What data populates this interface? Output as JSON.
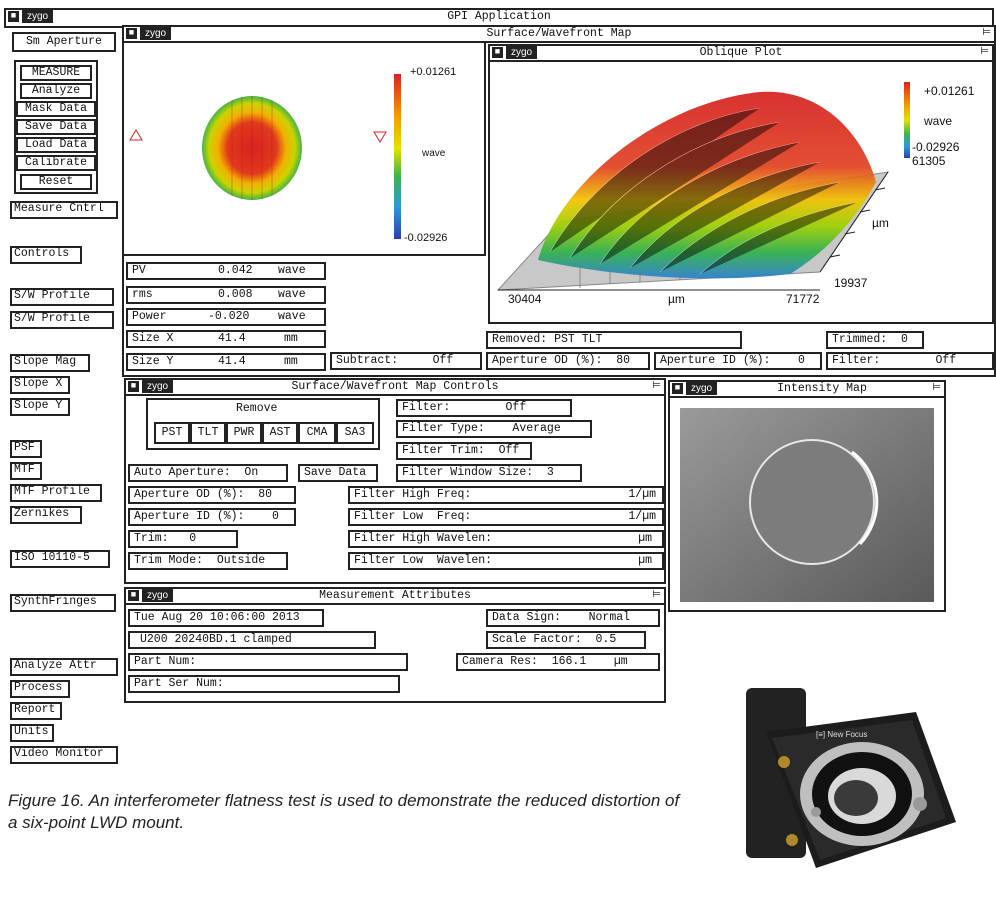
{
  "app": {
    "title": "GPI Application",
    "logo": "zygo"
  },
  "colors": {
    "frame": "#222222",
    "accent_red": "#dd2222",
    "accent_blue": "#2a3fb0"
  },
  "left_menu": {
    "sm_aperture": "Sm Aperture",
    "measure_group": [
      "MEASURE",
      "Analyze",
      "Mask Data",
      "Save Data",
      "Load Data",
      "Calibrate",
      "Reset"
    ],
    "measure_cntrl": "Measure Cntrl",
    "controls": "Controls",
    "sw_profile_1": "S/W Profile",
    "sw_profile_2": "S/W Profile",
    "slope_mag": "Slope Mag",
    "slope_x": "Slope X",
    "slope_y": "Slope Y",
    "psf": "PSF",
    "mtf": "MTF",
    "mtf_profile": "MTF Profile",
    "zernikes": "Zernikes",
    "iso": "ISO 10110-5",
    "synthfringes": "SynthFringes",
    "analyze_attr": "Analyze Attr",
    "process": "Process",
    "report": "Report",
    "units": "Units",
    "video_monitor": "Video Monitor"
  },
  "surface_map": {
    "title": "Surface/Wavefront Map",
    "colorbar_max": "+0.01261",
    "colorbar_min": "-0.02926",
    "colorbar_unit": "wave",
    "stats": [
      {
        "label": "PV",
        "value": "0.042",
        "unit": "wave"
      },
      {
        "label": "rms",
        "value": "0.008",
        "unit": "wave"
      },
      {
        "label": "Power",
        "value": "-0.020",
        "unit": "wave"
      },
      {
        "label": "Size X",
        "value": "41.4",
        "unit": "mm"
      },
      {
        "label": "Size Y",
        "value": "41.4",
        "unit": "mm"
      }
    ],
    "subtract": "Subtract:     Off",
    "removed": "Removed: PST TLT",
    "trimmed": "Trimmed:  0",
    "aperture_od": "Aperture OD (%):  80",
    "aperture_id": "Aperture ID (%):    0",
    "filter": "Filter:        Off"
  },
  "oblique_plot": {
    "title": "Oblique Plot",
    "legend_max": "+0.01261",
    "legend_unit": "wave",
    "legend_min": "-0.02926",
    "legend_min2": "61305",
    "axis_x_start": "30404",
    "axis_x_unit": "µm",
    "axis_x_end": "71772",
    "axis_y_unit": "µm",
    "axis_y_val": "19937"
  },
  "map_controls": {
    "title": "Surface/Wavefront Map Controls",
    "remove_label": "Remove",
    "remove_buttons": [
      "PST",
      "TLT",
      "PWR",
      "AST",
      "CMA",
      "SA3"
    ],
    "filter": "Filter:        Off",
    "filter_type": "Filter Type:    Average",
    "filter_trim": "Filter Trim:  Off",
    "auto_aperture": "Auto Aperture:  On",
    "save_data": "Save Data",
    "filter_window": "Filter Window Size:  3",
    "aperture_od": "Aperture OD (%):  80",
    "aperture_id": "Aperture ID (%):    0",
    "trim": "Trim:   0",
    "trim_mode": "Trim Mode:  Outside",
    "filter_rows": [
      {
        "label": "Filter High Freq:",
        "unit": "1/µm"
      },
      {
        "label": "Filter Low  Freq:",
        "unit": "1/µm"
      },
      {
        "label": "Filter High Wavelen:",
        "unit": "µm"
      },
      {
        "label": "Filter Low  Wavelen:",
        "unit": "µm"
      }
    ]
  },
  "intensity_map": {
    "title": "Intensity Map"
  },
  "attributes": {
    "title": "Measurement Attributes",
    "date": "Tue Aug 20 10:06:00 2013",
    "comment": "U200 20240BD.1 clamped",
    "part_num": "Part Num:",
    "part_ser": "Part Ser Num:",
    "data_sign": "Data Sign:    Normal",
    "scale_factor": "Scale Factor:  0.5",
    "camera_res": "Camera Res:  166.1    µm"
  },
  "caption": "Figure 16. An interferometer flatness test is used to demonstrate the reduced distortion of a six-point LWD mount.",
  "mount_label": "[≡] New Focus"
}
